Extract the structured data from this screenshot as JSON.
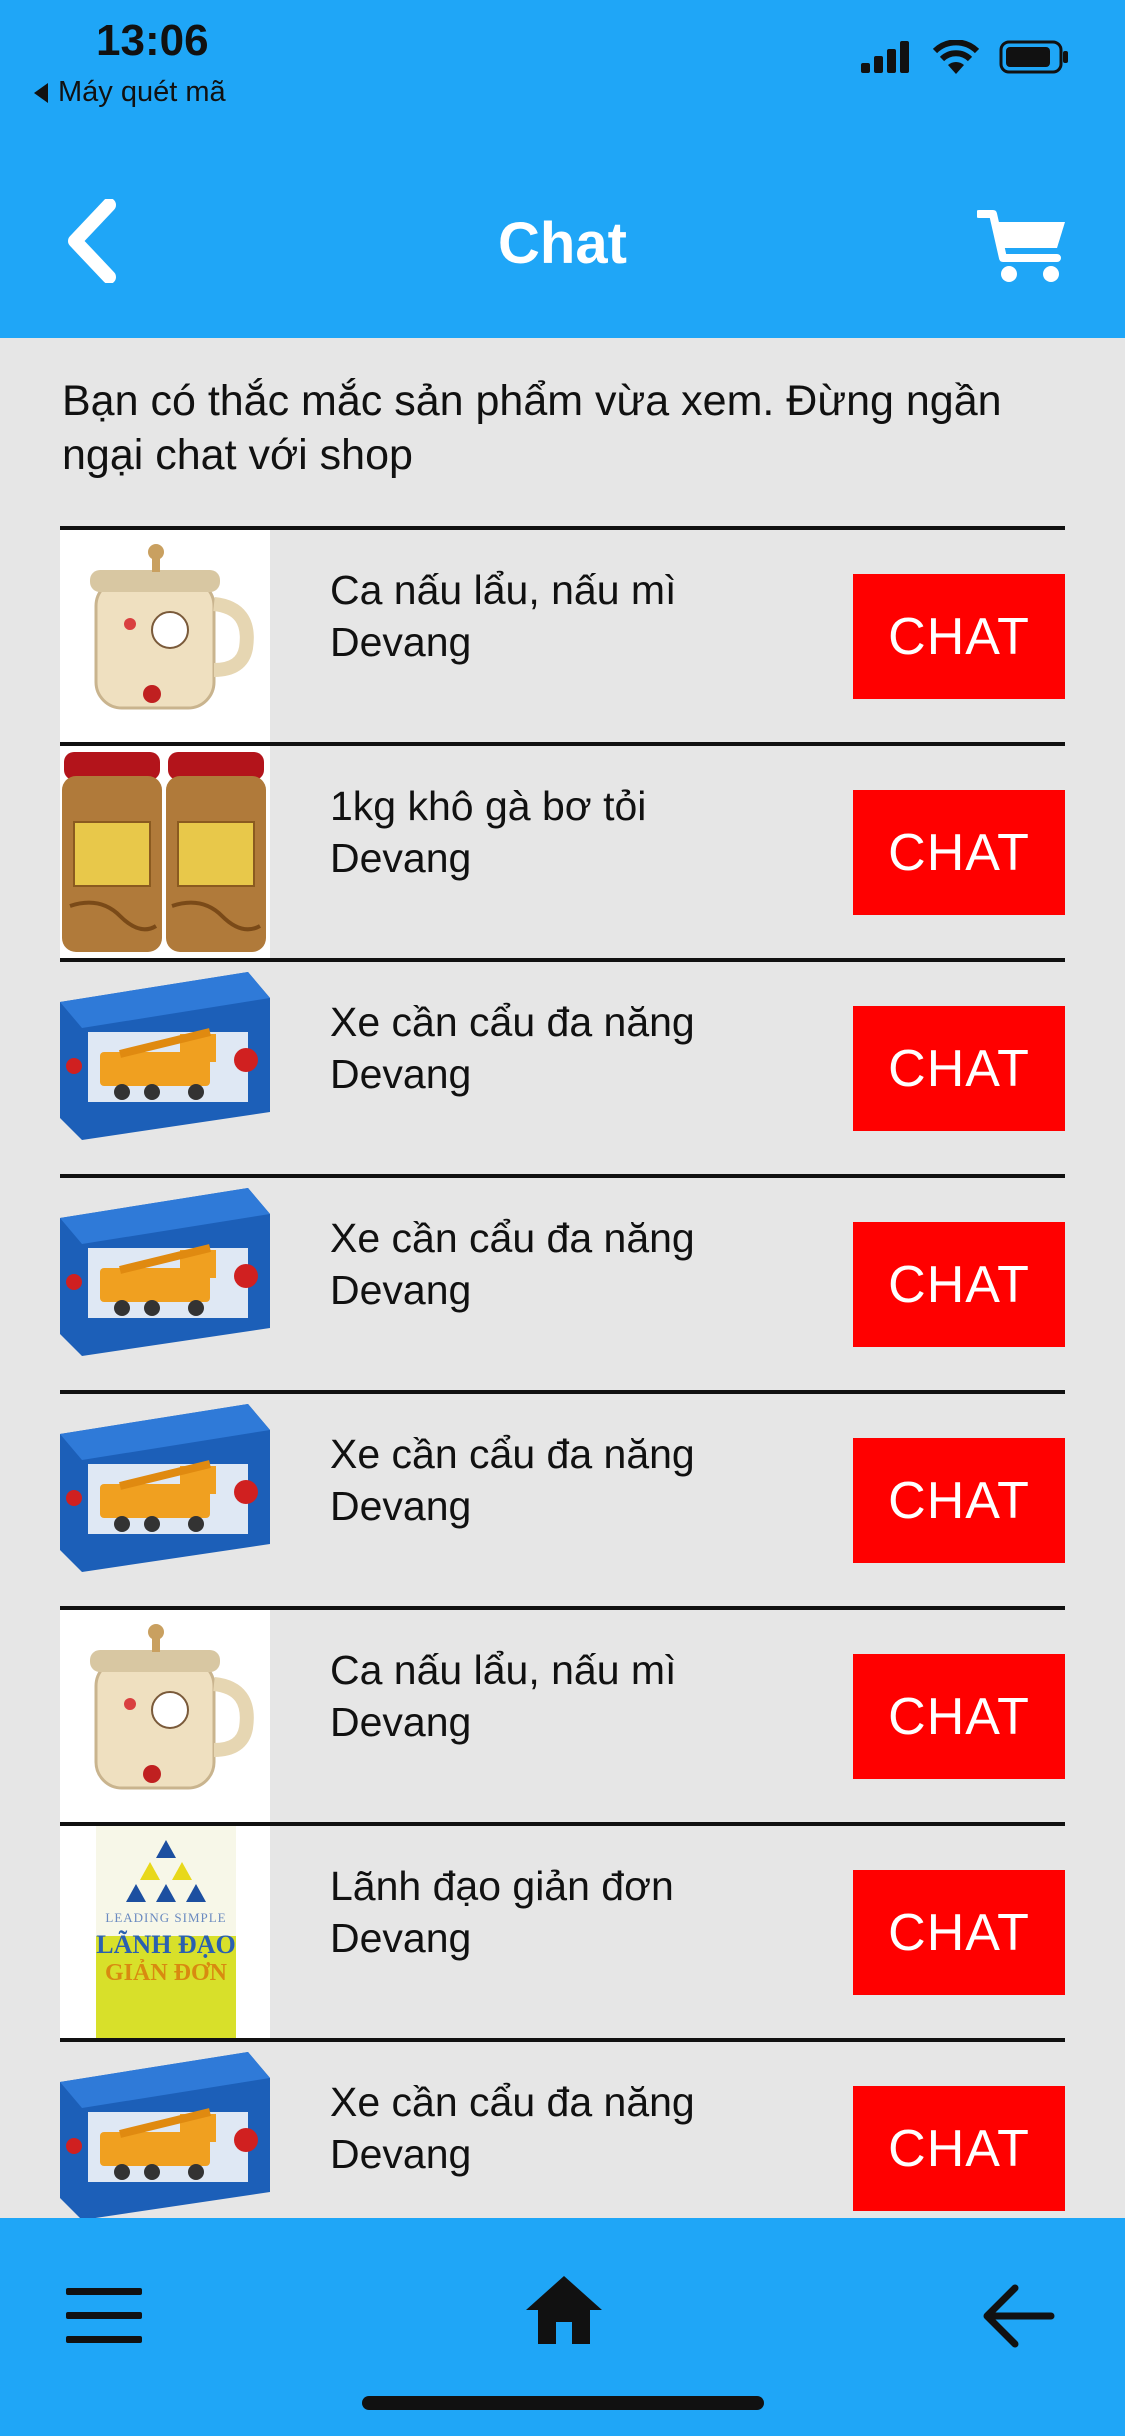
{
  "status_bar": {
    "time": "13:06",
    "back_app_label": "Máy quét mã",
    "icons": [
      "signal-icon",
      "wifi-icon",
      "battery-icon"
    ]
  },
  "header": {
    "title": "Chat",
    "back_icon": "chevron-left-icon",
    "cart_icon": "cart-icon"
  },
  "intro_text": "Bạn có thắc mắc sản phẩm vừa xem. Đừng ngần ngại chat với shop",
  "chat_button_label": "CHAT",
  "items": [
    {
      "name": "Ca nấu lẩu, nấu mì",
      "shop": "Devang",
      "image": "kettle"
    },
    {
      "name": "1kg khô gà bơ tỏi",
      "shop": "Devang",
      "image": "jars"
    },
    {
      "name": "Xe cần cẩu đa năng",
      "shop": "Devang",
      "image": "crane"
    },
    {
      "name": "Xe cần cẩu đa năng",
      "shop": "Devang",
      "image": "crane"
    },
    {
      "name": "Xe cần cẩu đa năng",
      "shop": "Devang",
      "image": "crane"
    },
    {
      "name": "Ca nấu lẩu, nấu mì",
      "shop": "Devang",
      "image": "kettle"
    },
    {
      "name": "Lãnh đạo giản đơn",
      "shop": "Devang",
      "image": "book"
    },
    {
      "name": "Xe cần cẩu đa năng",
      "shop": "Devang",
      "image": "crane"
    }
  ],
  "book_cover": {
    "line1": "LEADING SIMPLE",
    "line2": "LÃNH ĐẠO",
    "line3": "GIẢN ĐƠN"
  },
  "bottom_bar": {
    "icons": [
      "menu-icon",
      "home-icon",
      "arrow-left-icon"
    ]
  },
  "colors": {
    "header_bg": "#1fa6f7",
    "content_bg": "#e6e6e6",
    "chat_button_bg": "#ff0000"
  }
}
